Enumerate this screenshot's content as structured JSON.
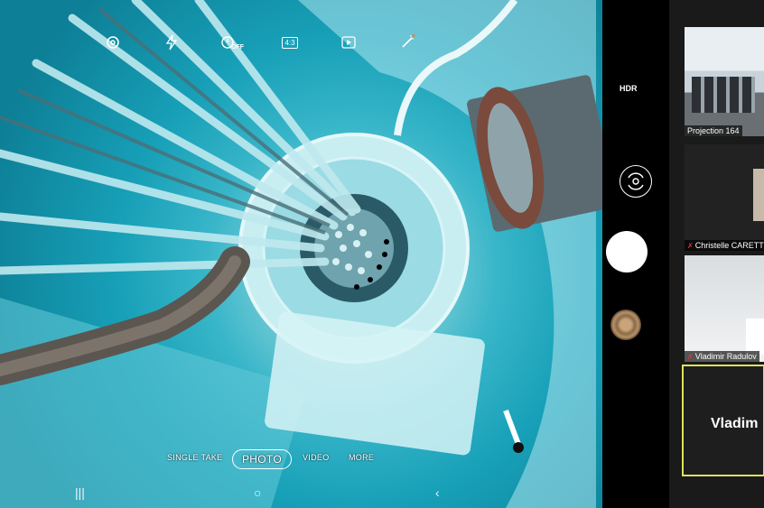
{
  "camera": {
    "top_icons": [
      "settings-icon",
      "flash-icon",
      "timer-off-icon",
      "ratio-icon",
      "motion-photo-icon",
      "filter-icon"
    ],
    "timer_label": "OFF",
    "ratio_label": "4:3",
    "modes": [
      "SINGLE TAKE",
      "PHOTO",
      "VIDEO",
      "MORE"
    ],
    "active_mode": "PHOTO",
    "hdr_label": "HDR"
  },
  "nav": {
    "recents": "|||",
    "home": "○",
    "back": "‹"
  },
  "zoom": {
    "participants": [
      {
        "name": "Projection 164"
      },
      {
        "name": "Christelle CARETT"
      },
      {
        "name": "Vladimir Radulov"
      }
    ],
    "active_speaker": "Vladim"
  },
  "colors": {
    "active_border": "#dfe35a",
    "muted_mic": "#e33333",
    "water": "#17a0b8"
  }
}
